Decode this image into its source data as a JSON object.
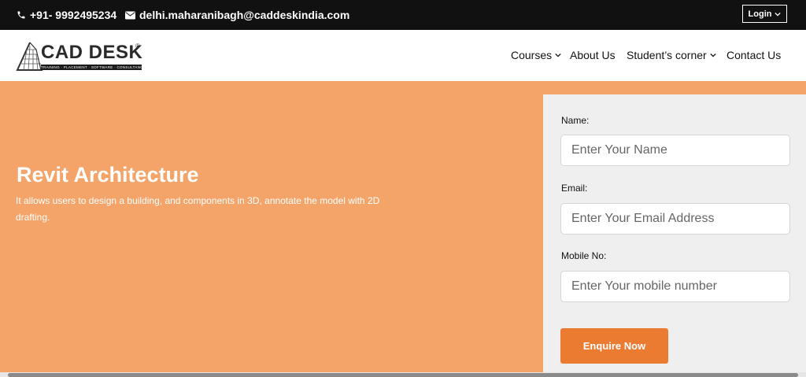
{
  "topbar": {
    "phone": "+91- 9992495234",
    "email": "delhi.maharanibagh@caddeskindia.com",
    "login_label": "Login"
  },
  "logo": {
    "name": "CAD DESK",
    "registered": "®",
    "tagline": "TRAINING · PLACEMENT · SOFTWARE · CONSULTANCY"
  },
  "nav": {
    "courses": "Courses",
    "about": "About Us",
    "student": "Student’s corner",
    "contact": "Contact Us"
  },
  "hero": {
    "title": "Revit Architecture",
    "description": "It allows users to design a building, and components in 3D, annotate the model with 2D drafting."
  },
  "form": {
    "name_label": "Name:",
    "name_placeholder": "Enter Your Name",
    "email_label": "Email:",
    "email_placeholder": "Enter Your Email Address",
    "mobile_label": "Mobile No:",
    "mobile_placeholder": "Enter Your mobile number",
    "submit_label": "Enquire Now"
  },
  "colors": {
    "topbar_bg": "#111111",
    "hero_bg": "#f4a469",
    "accent": "#ec7b32",
    "form_bg": "#efefef"
  },
  "icons": [
    "phone-icon",
    "envelope-icon",
    "chevron-down-icon"
  ]
}
